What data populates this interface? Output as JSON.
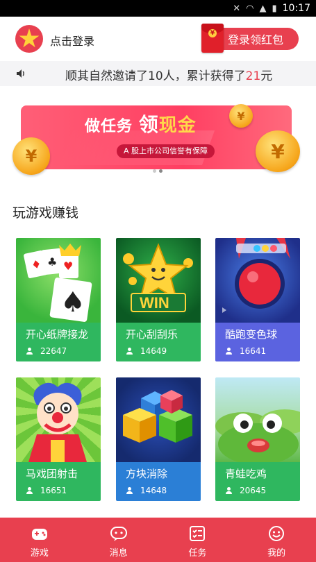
{
  "status_bar": {
    "time": "10:17"
  },
  "header": {
    "login_label": "点击登录",
    "redpacket_button_label": "登录领红包"
  },
  "notice": {
    "prefix": "顺其自然邀请了10人，累计获得了",
    "amount": "21",
    "suffix": "元"
  },
  "banner": {
    "title_part1": "做任务",
    "title_part2": "领",
    "title_part3": "现金",
    "subtitle": "A 股上市公司信誉有保障",
    "coin_symbol": "¥",
    "page_count": 2,
    "active_page": 1
  },
  "section_title": "玩游戏赚钱",
  "games": [
    {
      "name": "开心纸牌接龙",
      "players": "22647",
      "color": "#2fb75f"
    },
    {
      "name": "开心刮刮乐",
      "players": "14649",
      "color": "#2fb75f"
    },
    {
      "name": "酷跑变色球",
      "players": "16641",
      "color": "#5b63e0"
    },
    {
      "name": "马戏团射击",
      "players": "16651",
      "color": "#2fb75f"
    },
    {
      "name": "方块消除",
      "players": "14648",
      "color": "#2b7fd6"
    },
    {
      "name": "青蛙吃鸡",
      "players": "20645",
      "color": "#2fb75f"
    }
  ],
  "tabbar": {
    "tabs": [
      {
        "label": "游戏",
        "icon": "gamepad-icon"
      },
      {
        "label": "消息",
        "icon": "message-icon"
      },
      {
        "label": "任务",
        "icon": "task-icon"
      },
      {
        "label": "我的",
        "icon": "smiley-icon"
      }
    ]
  },
  "colors": {
    "accent": "#e8404f",
    "notice_bg": "#f4f4f6"
  }
}
